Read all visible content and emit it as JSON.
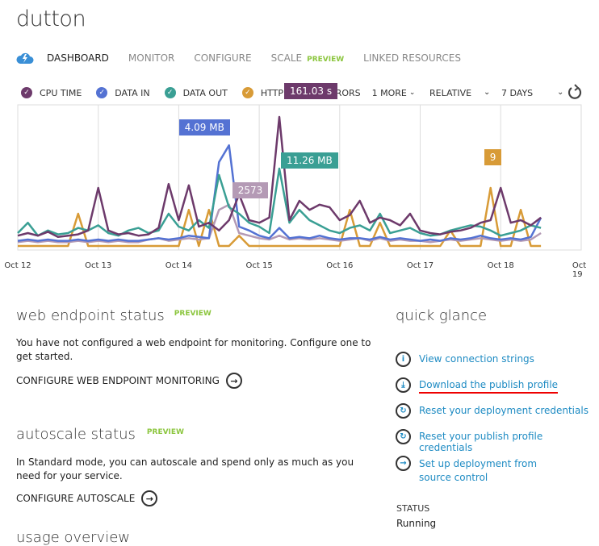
{
  "header": {
    "title": "dutton"
  },
  "tabs": [
    {
      "label": "DASHBOARD",
      "active": true
    },
    {
      "label": "MONITOR"
    },
    {
      "label": "CONFIGURE"
    },
    {
      "label": "SCALE",
      "badge": "PREVIEW"
    },
    {
      "label": "LINKED RESOURCES"
    }
  ],
  "legend": {
    "items": [
      {
        "label": "CPU TIME",
        "color": "#6d3a6b"
      },
      {
        "label": "DATA IN",
        "color": "#5472d3"
      },
      {
        "label": "DATA OUT",
        "color": "#3a9f94"
      },
      {
        "label": "HTTP SERVER ERRORS",
        "color": "#d89b37"
      }
    ],
    "more": "1 MORE",
    "scale": "RELATIVE",
    "range": "7 DAYS"
  },
  "chart_data": {
    "type": "line",
    "note_scale": "relative",
    "x_start": "Oct 12",
    "x_step_days": 0.125,
    "xticks": [
      "Oct 12",
      "Oct 13",
      "Oct 14",
      "Oct 15",
      "Oct 16",
      "Oct 17",
      "Oct 18",
      "Oct 19"
    ],
    "grid": true,
    "series": [
      {
        "name": "CPU TIME",
        "color": "#6d3a6b",
        "peak_label": "161.03 s",
        "values": [
          8,
          10,
          8,
          11,
          7,
          8,
          9,
          12,
          45,
          12,
          9,
          10,
          8,
          9,
          14,
          48,
          20,
          47,
          15,
          18,
          12,
          20,
          40,
          20,
          18,
          22,
          100,
          20,
          35,
          28,
          32,
          30,
          20,
          24,
          35,
          18,
          22,
          20,
          16,
          25,
          12,
          10,
          9,
          11,
          12,
          14,
          18,
          20,
          45,
          18,
          20,
          16,
          22
        ]
      },
      {
        "name": "DATA IN",
        "color": "#5472d3",
        "peak_label": "4.09 MB",
        "values": [
          4,
          5,
          4,
          5,
          4,
          4,
          5,
          4,
          5,
          4,
          5,
          4,
          4,
          5,
          6,
          5,
          6,
          8,
          7,
          6,
          65,
          78,
          15,
          12,
          8,
          6,
          14,
          6,
          7,
          6,
          8,
          6,
          5,
          6,
          6,
          5,
          7,
          5,
          6,
          5,
          4,
          5,
          4,
          6,
          5,
          6,
          8,
          6,
          5,
          6,
          5,
          7,
          22
        ]
      },
      {
        "name": "DATA OUT",
        "color": "#3a9f94",
        "peak_label": "11.26 MB",
        "values": [
          10,
          18,
          8,
          12,
          9,
          10,
          14,
          12,
          16,
          10,
          8,
          12,
          14,
          10,
          12,
          25,
          15,
          12,
          20,
          14,
          55,
          30,
          25,
          18,
          15,
          10,
          60,
          18,
          28,
          20,
          16,
          12,
          10,
          14,
          16,
          12,
          25,
          10,
          12,
          14,
          10,
          8,
          9,
          12,
          14,
          16,
          15,
          12,
          8,
          10,
          12,
          16,
          14
        ]
      },
      {
        "name": "HTTP SERVER ERRORS",
        "color": "#d89b37",
        "peak_label": "9",
        "values": [
          0,
          0,
          0,
          0,
          0,
          0,
          25,
          0,
          0,
          0,
          0,
          0,
          0,
          0,
          0,
          0,
          0,
          28,
          0,
          28,
          0,
          0,
          8,
          0,
          0,
          0,
          0,
          0,
          0,
          0,
          0,
          0,
          0,
          28,
          0,
          0,
          18,
          0,
          0,
          0,
          0,
          0,
          0,
          12,
          0,
          0,
          0,
          45,
          0,
          0,
          28,
          0,
          0
        ]
      },
      {
        "name": "1 MORE",
        "color": "#b49ab5",
        "peak_label": "2573",
        "values": [
          3,
          4,
          3,
          4,
          3,
          3,
          4,
          3,
          4,
          3,
          4,
          3,
          3,
          5,
          6,
          4,
          5,
          6,
          5,
          6,
          28,
          32,
          10,
          8,
          6,
          5,
          8,
          5,
          6,
          5,
          6,
          5,
          4,
          5,
          6,
          4,
          6,
          4,
          5,
          4,
          4,
          3,
          4,
          5,
          4,
          5,
          6,
          5,
          4,
          5,
          4,
          5,
          10
        ]
      }
    ]
  },
  "web_endpoint": {
    "title": "web endpoint status",
    "badge": "PREVIEW",
    "text": "You have not configured a web endpoint for monitoring. Configure one to get started.",
    "action": "CONFIGURE WEB ENDPOINT MONITORING"
  },
  "autoscale": {
    "title": "autoscale status",
    "badge": "PREVIEW",
    "text": "In Standard mode, you can autoscale and spend only as much as you need for your service.",
    "action": "CONFIGURE AUTOSCALE"
  },
  "usage": {
    "title": "usage overview"
  },
  "quick_glance": {
    "title": "quick glance",
    "links": [
      {
        "label": "View connection strings",
        "icon": "info-icon"
      },
      {
        "label": "Download the publish profile",
        "icon": "download-icon"
      },
      {
        "label": "Reset your deployment credentials",
        "icon": "reset-icon"
      },
      {
        "label": "Reset your publish profile credentials",
        "icon": "reset-icon"
      },
      {
        "label": "Set up deployment from source control",
        "icon": "arrow-right-icon"
      }
    ],
    "status_label": "STATUS",
    "status_value": "Running"
  }
}
